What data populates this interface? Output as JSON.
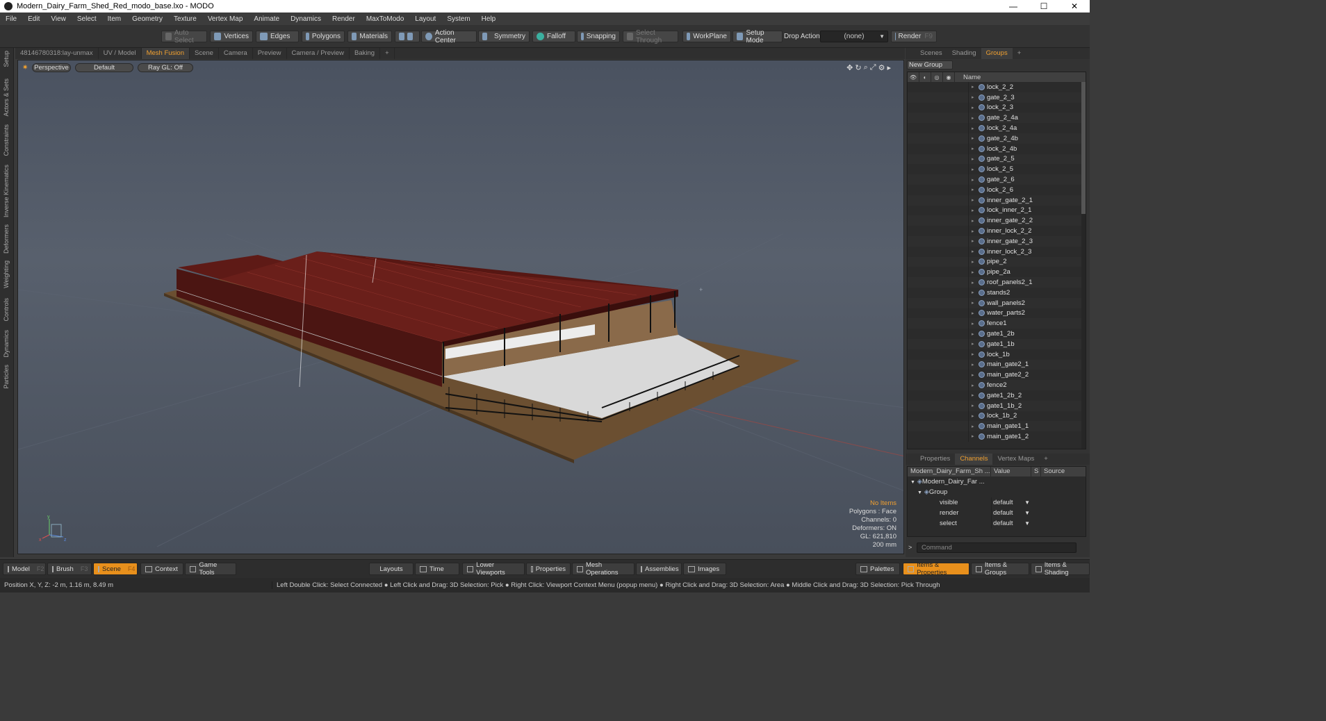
{
  "window": {
    "title": "Modern_Dairy_Farm_Shed_Red_modo_base.lxo - MODO",
    "min": "—",
    "max": "☐",
    "close": "✕"
  },
  "menu": [
    "File",
    "Edit",
    "View",
    "Select",
    "Item",
    "Geometry",
    "Texture",
    "Vertex Map",
    "Animate",
    "Dynamics",
    "Render",
    "MaxToModo",
    "Layout",
    "System",
    "Help"
  ],
  "toolbar": {
    "auto_select": "Auto Select",
    "vertices": "Vertices",
    "edges": "Edges",
    "polygons": "Polygons",
    "materials": "Materials",
    "action_center": "Action Center",
    "symmetry": "Symmetry",
    "falloff": "Falloff",
    "snapping": "Snapping",
    "select_through": "Select Through",
    "workplane": "WorkPlane",
    "setup_mode": "Setup Mode",
    "drop_action": "Drop Action",
    "drop_value": "(none)",
    "render": "Render",
    "render_key": "F9"
  },
  "left_tabs": [
    "Setup",
    "Actors & Sets",
    "Constraints",
    "Inverse Kinematics",
    "Deformers",
    "Weighting",
    "Controls",
    "Dynamics",
    "Particles"
  ],
  "viewport_tabs": [
    "48146780318:lay-unmax",
    "UV / Model",
    "Mesh Fusion",
    "Scene",
    "Camera",
    "Preview",
    "Camera / Preview",
    "Baking",
    "+"
  ],
  "viewport_tab_active": "Mesh Fusion",
  "viewport": {
    "view_mode": "Perspective",
    "shading": "Default",
    "raygl": "Ray GL: Off",
    "info": {
      "no_items": "No Items",
      "polygons": "Polygons : Face",
      "channels": "Channels: 0",
      "deformers": "Deformers: ON",
      "gl": "GL: 621,810",
      "scale": "200 mm"
    },
    "axis": {
      "x": "x",
      "y": "y",
      "z": "z"
    }
  },
  "right_tabs": [
    "Scenes",
    "Shading",
    "Groups",
    "+"
  ],
  "right_tab_active": "Groups",
  "new_group": "New Group",
  "list_header": {
    "name": "Name"
  },
  "groups": [
    "lock_2_2",
    "gate_2_3",
    "lock_2_3",
    "gate_2_4a",
    "lock_2_4a",
    "gate_2_4b",
    "lock_2_4b",
    "gate_2_5",
    "lock_2_5",
    "gate_2_6",
    "lock_2_6",
    "inner_gate_2_1",
    "lock_inner_2_1",
    "inner_gate_2_2",
    "inner_lock_2_2",
    "inner_gate_2_3",
    "inner_lock_2_3",
    "pipe_2",
    "pipe_2a",
    "roof_panels2_1",
    "stands2",
    "wall_panels2",
    "water_parts2",
    "fence1",
    "gate1_2b",
    "gate1_1b",
    "lock_1b",
    "main_gate2_1",
    "main_gate2_2",
    "fence2",
    "gate1_2b_2",
    "gate1_1b_2",
    "lock_1b_2",
    "main_gate1_1",
    "main_gate1_2"
  ],
  "props_tabs": [
    "Properties",
    "Channels",
    "Vertex Maps",
    "+"
  ],
  "props_tab_active": "Channels",
  "channels": {
    "header": {
      "name": "Modern_Dairy_Farm_Sh ...",
      "value": "Value",
      "s": "S",
      "source": "Source"
    },
    "root": "Modern_Dairy_Far ...",
    "group": "Group",
    "rows": [
      {
        "name": "visible",
        "value": "default"
      },
      {
        "name": "render",
        "value": "default"
      },
      {
        "name": "select",
        "value": "default"
      }
    ]
  },
  "command_placeholder": "Command",
  "bottom": {
    "model": "Model",
    "model_key": "F2",
    "brush": "Brush",
    "brush_key": "F3",
    "scene": "Scene",
    "scene_key": "F4",
    "context": "Context",
    "game_tools": "Game Tools",
    "layouts": "Layouts",
    "time": "Time",
    "lower_viewports": "Lower Viewports",
    "properties": "Properties",
    "mesh_operations": "Mesh Operations",
    "assemblies": "Assemblies",
    "images": "Images",
    "palettes": "Palettes",
    "items_properties": "Items & Properties",
    "items_groups": "Items & Groups",
    "items_shading": "Items & Shading"
  },
  "status": {
    "position": "Position X, Y, Z:   -2 m, 1.16 m, 8.49 m",
    "hints": "Left Double Click: Select Connected ● Left Click and Drag: 3D Selection: Pick ● Right Click: Viewport Context Menu (popup menu) ● Right Click and Drag: 3D Selection: Area ● Middle Click and Drag: 3D Selection: Pick Through"
  },
  "colors": {
    "accent": "#f0a030",
    "roof": "#5e1a16",
    "viewport_bg": "#505865"
  }
}
